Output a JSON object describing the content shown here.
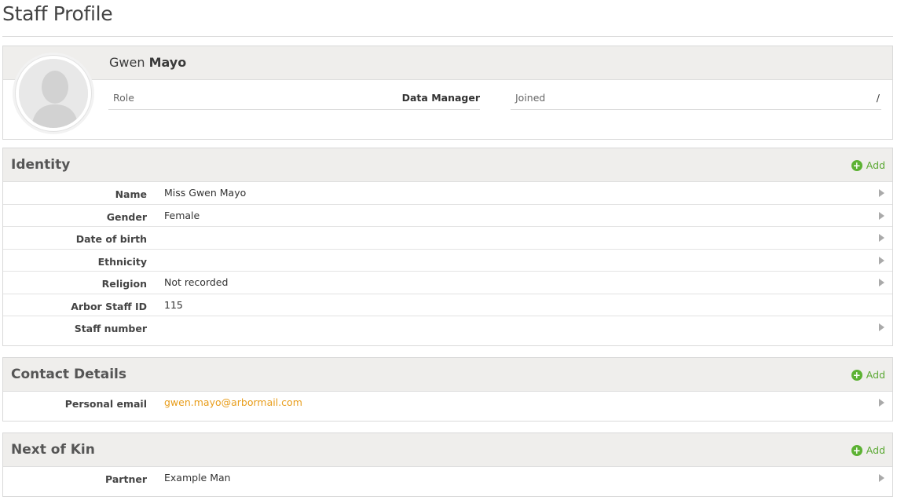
{
  "page": {
    "title": "Staff Profile"
  },
  "profile": {
    "first_name": "Gwen",
    "last_name": "Mayo",
    "role_label": "Role",
    "role_value": "Data Manager",
    "joined_label": "Joined",
    "joined_value": "/"
  },
  "identity": {
    "title": "Identity",
    "add_label": "Add",
    "rows": [
      {
        "label": "Name",
        "value": "Miss Gwen Mayo",
        "chevron": true
      },
      {
        "label": "Gender",
        "value": "Female",
        "chevron": true
      },
      {
        "label": "Date of birth",
        "value": "",
        "chevron": true
      },
      {
        "label": "Ethnicity",
        "value": "",
        "chevron": true
      },
      {
        "label": "Religion",
        "value": "Not recorded",
        "chevron": true
      },
      {
        "label": "Arbor Staff ID",
        "value": "115",
        "chevron": false
      },
      {
        "label": "Staff number",
        "value": "",
        "chevron": true
      }
    ]
  },
  "contact": {
    "title": "Contact Details",
    "add_label": "Add",
    "rows": [
      {
        "label": "Personal email",
        "value": "gwen.mayo@arbormail.com",
        "chevron": true,
        "link": true
      }
    ]
  },
  "kin": {
    "title": "Next of Kin",
    "add_label": "Add",
    "rows": [
      {
        "label": "Partner",
        "value": "Example Man",
        "chevron": true
      }
    ]
  },
  "colors": {
    "accent_green": "#5cb233",
    "link_orange": "#e89d1b",
    "header_bg": "#efeeec"
  },
  "icons": {
    "add": "plus-circle-icon",
    "row_chevron": "chevron-right-icon",
    "avatar": "user-silhouette-icon"
  }
}
